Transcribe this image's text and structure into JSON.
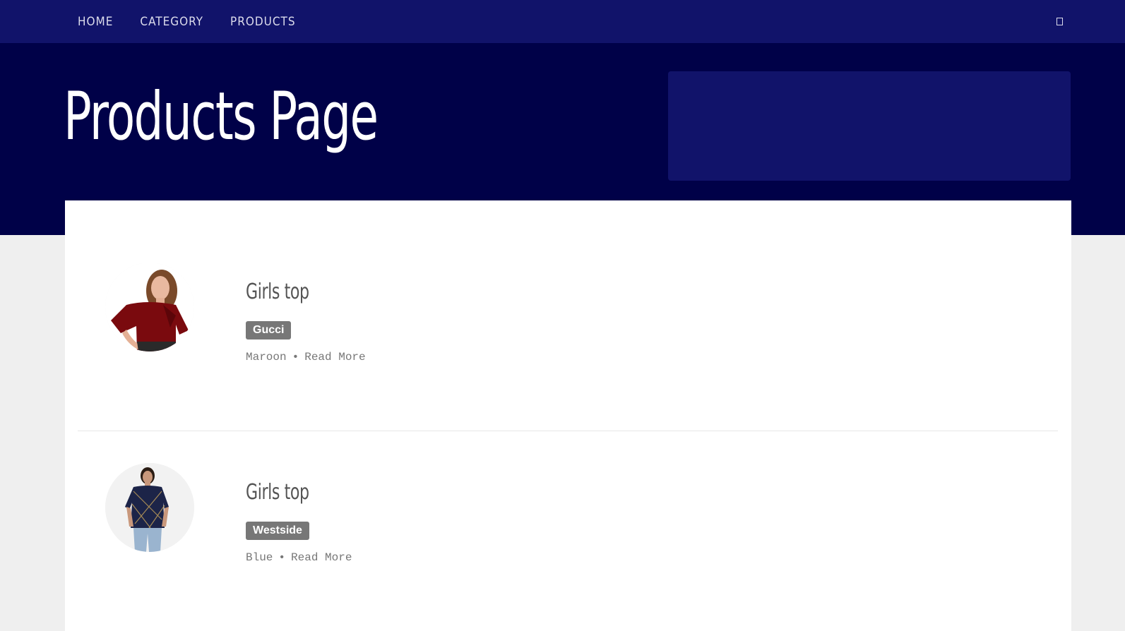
{
  "nav": {
    "items": [
      {
        "label": "HOME"
      },
      {
        "label": "CATEGORY"
      },
      {
        "label": "PRODUCTS"
      }
    ],
    "icon": "square-icon"
  },
  "hero": {
    "title": "Products Page"
  },
  "products": [
    {
      "title": "Girls top",
      "brand": "Gucci",
      "color": "Maroon",
      "separator": "•",
      "read_more": "Read More",
      "image": "maroon-top-model"
    },
    {
      "title": "Girls top",
      "brand": "Westside",
      "color": "Blue",
      "separator": "•",
      "read_more": "Read More",
      "image": "blue-check-top-model"
    }
  ],
  "colors": {
    "nav_bg": "#11136a",
    "hero_bg": "#000148",
    "page_bg": "#efefef",
    "badge_bg": "#777777"
  }
}
